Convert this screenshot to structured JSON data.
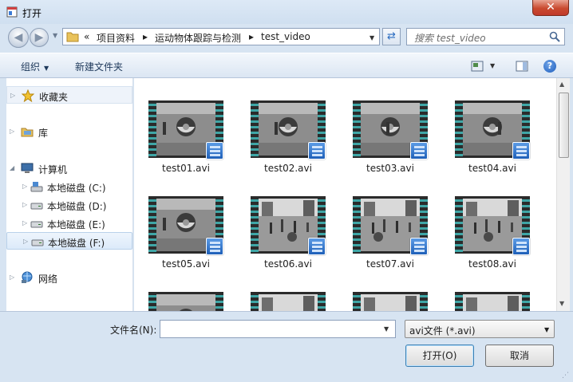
{
  "window": {
    "title": "打开",
    "close_label": "✕"
  },
  "address": {
    "prefix": "«",
    "crumbs": [
      "项目资料",
      "运动物体跟踪与检测",
      "test_video"
    ],
    "separator": "▸"
  },
  "search": {
    "placeholder": "搜索 test_video"
  },
  "toolbar": {
    "organize_label": "组织",
    "new_folder_label": "新建文件夹",
    "help_label": "?"
  },
  "nav": {
    "favorites": "收藏夹",
    "libraries": "库",
    "computer": "计算机",
    "drives": [
      "本地磁盘 (C:)",
      "本地磁盘 (D:)",
      "本地磁盘 (E:)",
      "本地磁盘 (F:)"
    ],
    "network": "网络"
  },
  "files": [
    "test01.avi",
    "test02.avi",
    "test03.avi",
    "test04.avi",
    "test05.avi",
    "test06.avi",
    "test07.avi",
    "test08.avi"
  ],
  "bottom": {
    "filename_label": "文件名(N):",
    "filename_value": "",
    "filetype_value": "avi文件 (*.avi)",
    "open_label": "打开(O)",
    "cancel_label": "取消"
  },
  "colors": {
    "accent": "#2a6cc0",
    "film_strip": "#3fa6a6",
    "close_red": "#c0392b"
  },
  "icons": {
    "app": "dialog-icon",
    "back": "back-arrow-icon",
    "forward": "forward-arrow-icon",
    "folder": "folder-icon",
    "refresh": "refresh-icon",
    "search": "search-icon",
    "view": "view-options-icon",
    "preview": "preview-pane-icon",
    "help": "help-icon",
    "favorites": "star-icon",
    "libraries": "library-icon",
    "computer": "computer-icon",
    "drive": "drive-icon",
    "network": "network-icon",
    "video": "video-file-icon"
  }
}
